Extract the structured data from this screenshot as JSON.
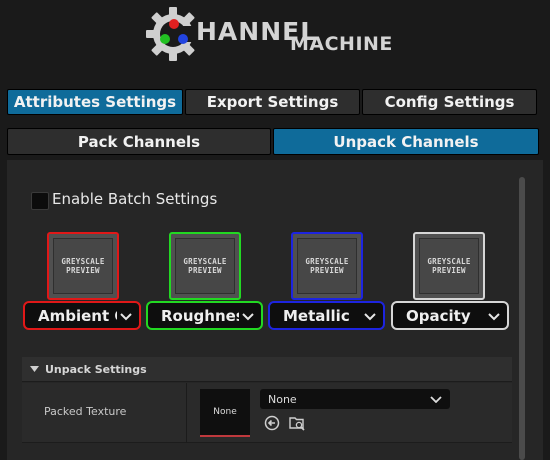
{
  "logo": {
    "text1": "HANNEL",
    "text2": "MACHINE",
    "dot_colors": [
      "#e02020",
      "#22c022",
      "#2244e0"
    ]
  },
  "top_tabs": [
    {
      "label": "Attributes Settings",
      "active": true
    },
    {
      "label": "Export Settings",
      "active": false
    },
    {
      "label": "Config Settings",
      "active": false
    }
  ],
  "mode_tabs": [
    {
      "label": "Pack Channels",
      "active": false
    },
    {
      "label": "Unpack Channels",
      "active": true
    }
  ],
  "batch": {
    "label": "Enable Batch Settings",
    "checked": false
  },
  "channels": [
    {
      "name": "Ambient Occlusion",
      "visible_label": "Ambient O",
      "color": "#e01818",
      "preview": [
        "GREYSCALE",
        "PREVIEW"
      ]
    },
    {
      "name": "Roughness",
      "visible_label": "Roughnes",
      "color": "#22d822",
      "preview": [
        "GREYSCALE",
        "PREVIEW"
      ]
    },
    {
      "name": "Metallic",
      "visible_label": "Metallic",
      "color": "#1d24e0",
      "preview": [
        "GREYSCALE",
        "PREVIEW"
      ]
    },
    {
      "name": "Opacity",
      "visible_label": "Opacity",
      "color": "#d6d6d6",
      "preview": [
        "GREYSCALE",
        "PREVIEW"
      ]
    }
  ],
  "unpack_settings": {
    "title": "Unpack Settings",
    "rows": [
      {
        "label": "Packed Texture",
        "thumbnail_text": "None",
        "selected": "None",
        "icons": [
          "use-selected-asset-icon",
          "browse-asset-icon"
        ]
      }
    ]
  }
}
